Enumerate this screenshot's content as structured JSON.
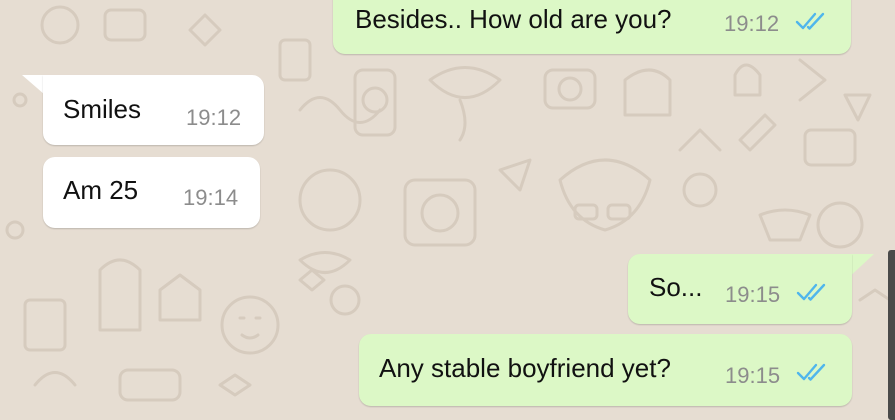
{
  "chat": {
    "messages": [
      {
        "direction": "outgoing",
        "text": "Besides.. How old are you?",
        "time": "19:12",
        "status": "read"
      },
      {
        "direction": "incoming",
        "text": "Smiles",
        "time": "19:12"
      },
      {
        "direction": "incoming",
        "text": "Am 25",
        "time": "19:14"
      },
      {
        "direction": "outgoing",
        "text": "So...",
        "time": "19:15",
        "status": "read"
      },
      {
        "direction": "outgoing",
        "text": "Any stable boyfriend yet?",
        "time": "19:15",
        "status": "read"
      }
    ]
  },
  "colors": {
    "background": "#e6ddd2",
    "incoming_bubble": "#ffffff",
    "outgoing_bubble": "#dcf8c6",
    "read_ticks": "#4fb6ec"
  }
}
